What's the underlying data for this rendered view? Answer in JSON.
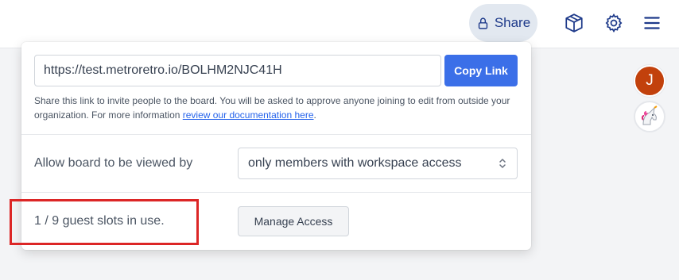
{
  "topbar": {
    "share_label": "Share",
    "icons": [
      "lock-icon",
      "box-icon",
      "gear-icon",
      "menu-icon"
    ]
  },
  "share_popup": {
    "url_value": "https://test.metroretro.io/BOLHM2NJC41H",
    "copy_label": "Copy Link",
    "help_text_1": "Share this link to invite people to the board. You will be asked to approve anyone joining to edit from outside your organization. For more information ",
    "help_link": "review our documentation here",
    "help_text_2": ".",
    "view_label": "Allow board to be viewed by",
    "view_selected": "only members with workspace access",
    "guest_slots": "1 / 9 guest slots in use.",
    "manage_label": "Manage Access"
  },
  "avatars": {
    "user_initial": "J"
  },
  "colors": {
    "accent": "#3b6fe8",
    "highlight": "#dc2626",
    "avatar": "#c2410c"
  }
}
